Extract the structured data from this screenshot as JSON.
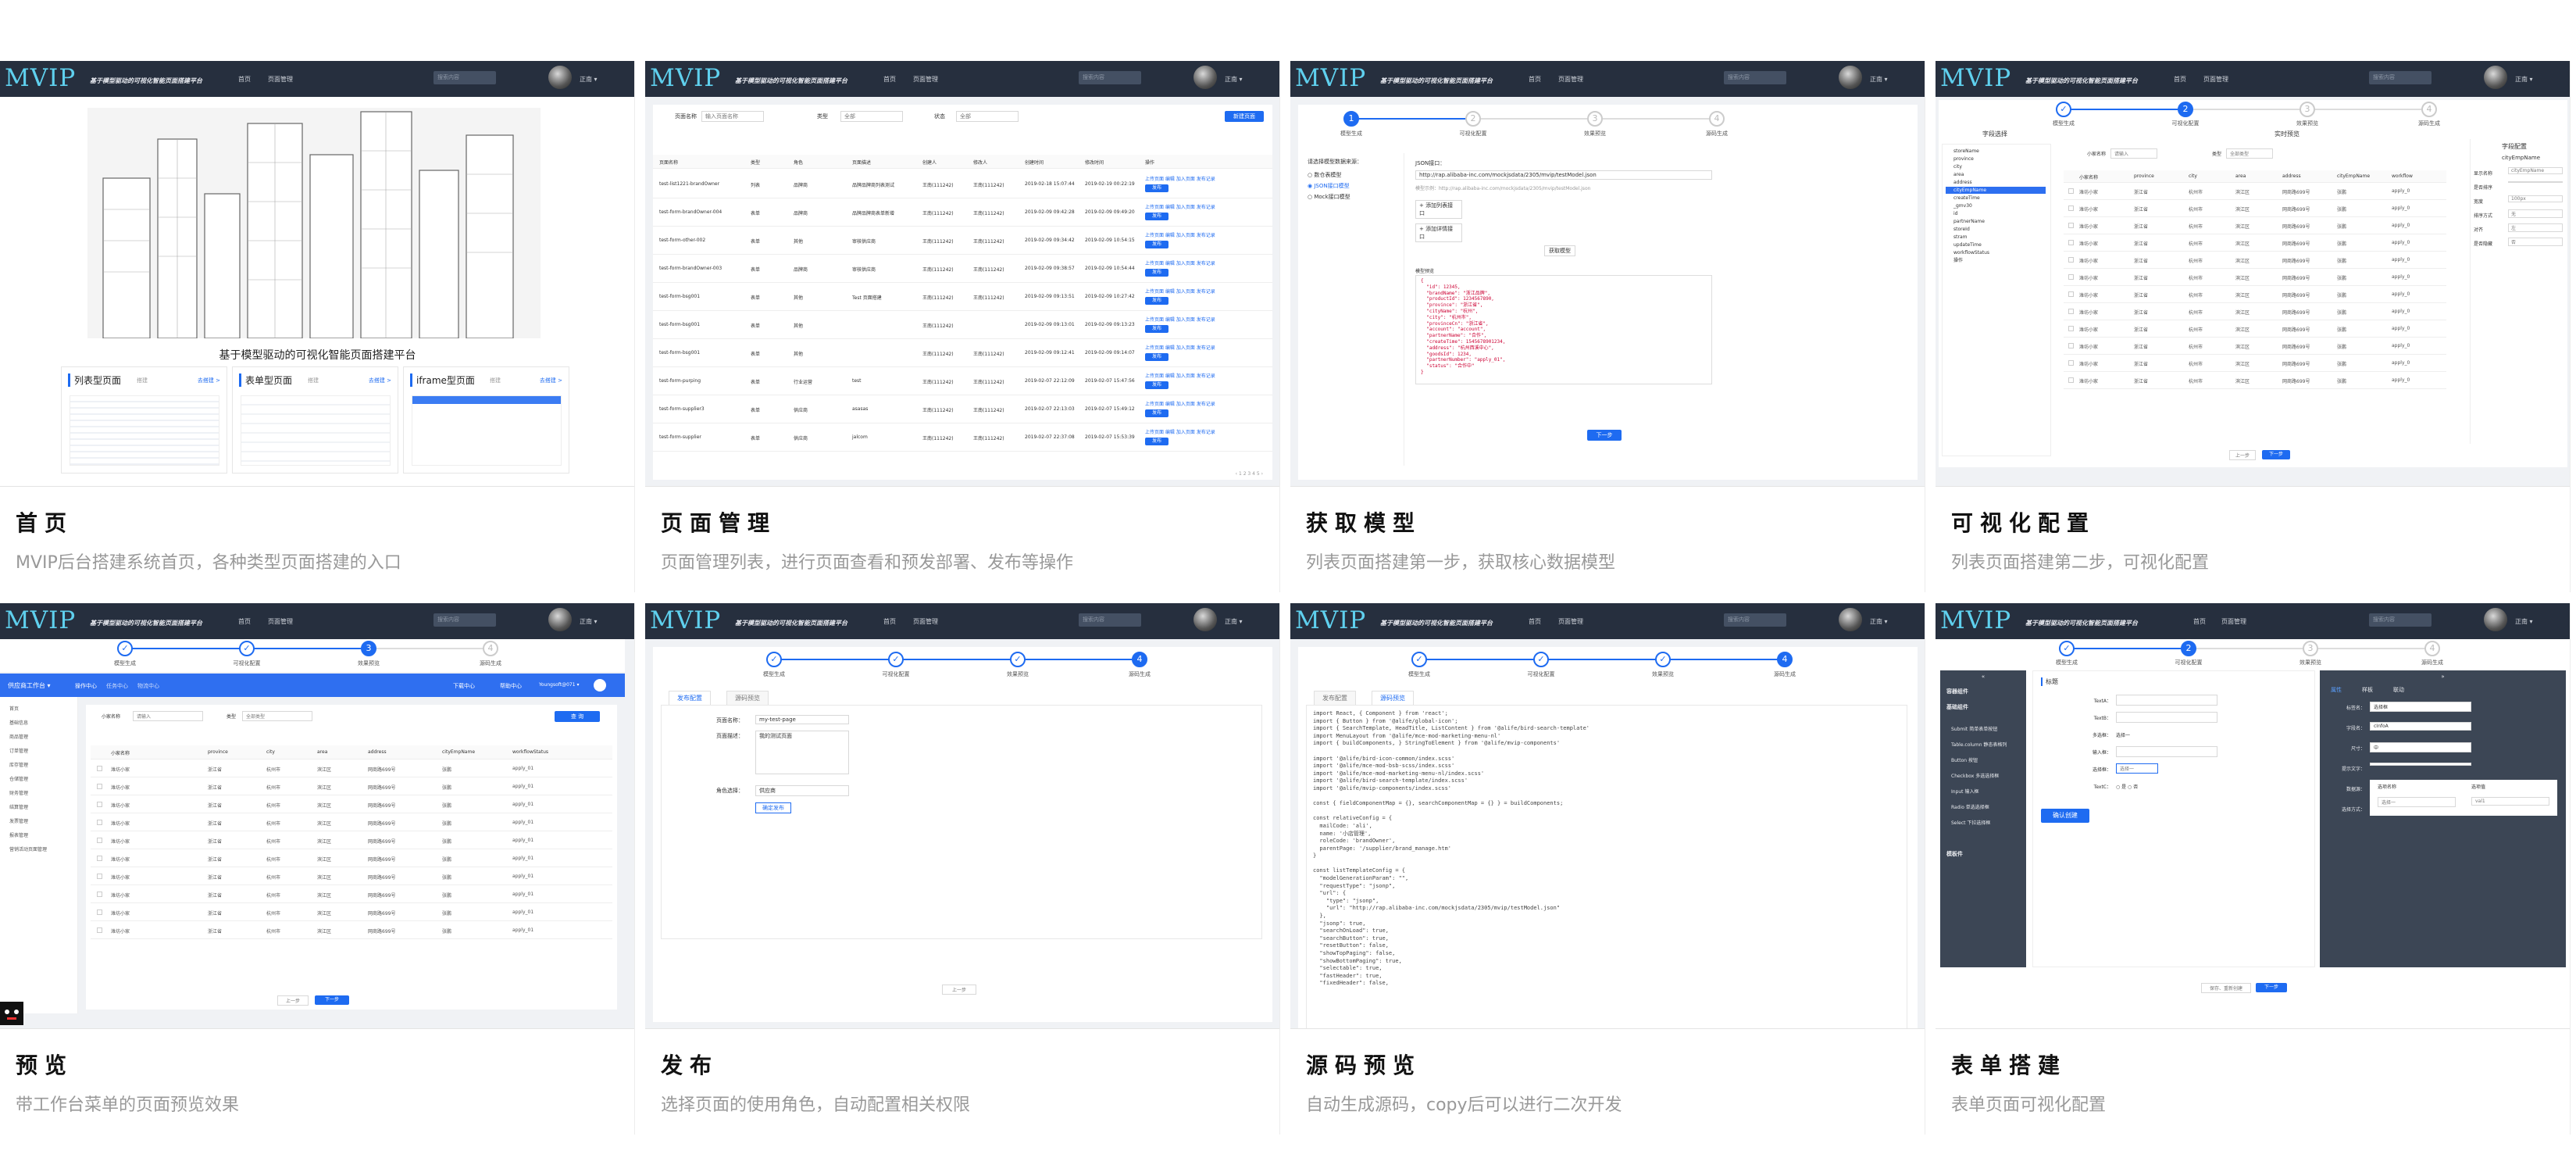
{
  "shared": {
    "logo": "MVIP",
    "subtitle": "基于模型驱动的可视化智能页面搭建平台",
    "nav_home": "首页",
    "nav_pages": "页面管理",
    "search_placeholder": "搜索内容",
    "user": "正南 ▾",
    "step_labels": [
      "模型生成",
      "可视化配置",
      "效果预览",
      "源码生成"
    ],
    "prev": "上一步",
    "next": "下一步"
  },
  "cards": [
    {
      "title": "首页",
      "desc": "MVIP后台搭建系统首页，各种类型页面搭建的入口"
    },
    {
      "title": "页面管理",
      "desc": "页面管理列表，进行页面查看和预发部署、发布等操作"
    },
    {
      "title": "获取模型",
      "desc": "列表页面搭建第一步，获取核心数据模型"
    },
    {
      "title": "可视化配置",
      "desc": "列表页面搭建第二步，可视化配置"
    },
    {
      "title": "预览",
      "desc": "带工作台菜单的页面预览效果"
    },
    {
      "title": "发布",
      "desc": "选择页面的使用角色，自动配置相关权限"
    },
    {
      "title": "源码预览",
      "desc": "自动生成源码，copy后可以进行二次开发"
    },
    {
      "title": "表单搭建",
      "desc": "表单页面可视化配置"
    }
  ],
  "home": {
    "caption": "基于模型驱动的可视化智能页面搭建平台",
    "tiles": [
      {
        "title": "列表型页面",
        "tag": "搭建",
        "link": "去搭建 >"
      },
      {
        "title": "表单型页面",
        "tag": "搭建",
        "link": "去搭建 >"
      },
      {
        "title": "iframe型页面",
        "tag": "搭建",
        "link": "去搭建 >"
      }
    ]
  },
  "pages": {
    "filter_name": "页面名称",
    "filter_name_ph": "输入页面名称",
    "filter_type": "类型",
    "filter_type_val": "全部",
    "filter_status": "状态",
    "filter_status_val": "全部",
    "new_button": "新建页面",
    "columns": [
      "页面名称",
      "类型",
      "角色",
      "页面描述",
      "创建人",
      "修改人",
      "创建时间",
      "修改时间",
      "操作"
    ],
    "rows": [
      [
        "test-list1221-brandOwner",
        "列表",
        "品牌商",
        "品牌品牌商列表测试",
        "王南(111242)",
        "王南(111242)",
        "2019-02-18 15:07:44",
        "2019-02-19 00:22:19"
      ],
      [
        "test-form-brandOwner-004",
        "表单",
        "品牌商",
        "品牌品牌商表单新增",
        "王南(111242)",
        "王南(111242)",
        "2019-02-09 09:42:28",
        "2019-02-09 09:49:20"
      ],
      [
        "test-form-other-002",
        "表单",
        "其他",
        "审核供应商",
        "王南(111242)",
        "王南(111242)",
        "2019-02-09 09:34:42",
        "2019-02-09 10:54:15"
      ],
      [
        "test-form-brandOwner-003",
        "表单",
        "品牌商",
        "审核供应商",
        "王南(111242)",
        "王南(111242)",
        "2019-02-09 09:38:57",
        "2019-02-09 10:54:44"
      ],
      [
        "test-form-bsg001",
        "表单",
        "其他",
        "Test 页面搭建",
        "王南(111242)",
        "王南(111242)",
        "2019-02-09 09:13:51",
        "2019-02-09 10:27:42"
      ],
      [
        "test-form-bsg001",
        "表单",
        "其他",
        "",
        "王南(111242)",
        "",
        "2019-02-09 09:13:01",
        "2019-02-09 09:13:23"
      ],
      [
        "test-form-bsg001",
        "表单",
        "其他",
        "",
        "王南(111242)",
        "王南(111242)",
        "2019-02-09 09:12:41",
        "2019-02-09 09:14:07"
      ],
      [
        "test-form-purping",
        "表单",
        "行业运营",
        "test",
        "王南(111242)",
        "王南(111242)",
        "2019-02-07 22:12:09",
        "2019-02-07 15:47:56"
      ],
      [
        "test-form-supplier3",
        "表单",
        "供应商",
        "asasas",
        "王南(111242)",
        "王南(111242)",
        "2019-02-07 22:13:03",
        "2019-02-07 15:49:12"
      ],
      [
        "test-form-supplier",
        "表单",
        "供应商",
        "jalcom",
        "王南(111242)",
        "王南(111242)",
        "2019-02-07 22:37:08",
        "2019-02-07 15:53:39"
      ]
    ],
    "action_links": "上传页面 编辑 加入页面 发布记录",
    "action_btn": "发布"
  },
  "model": {
    "choose_label": "请选择模型数据来源：",
    "options": [
      "数仓表模型",
      "JSON接口模型",
      "Mock接口模型"
    ],
    "json_label": "JSON接口：",
    "json_url": "http://rap.alibaba-inc.com/mockjsdata/2305/mvip/testModel.json",
    "hint": "模型示例：http://rap.alibaba-inc.com/mockjsdata/2305/mvip/testModel.json",
    "add_list": "+ 添加列表接口",
    "add_detail": "+ 添加详情接口",
    "get_model": "获取模型",
    "preview_label": "模型预览",
    "code": "{\n  \"id\": 12345,\n  \"brandName\": \"浙江品牌\",\n  \"productId\": 1234567890,\n  \"province\": \"浙江省\",\n  \"cityName\": \"杭州\",\n  \"city\": \"杭州市\",\n  \"provinceCn\": \"浙江省\",\n  \"account\": \"account\",\n  \"partnerName\": \"合作\",\n  \"createTime\": 1545678901234,\n  \"address\": \"杭州西溪中心\",\n  \"goodsId\": 1234,\n  \"partnerNumber\": \"apply_01\",\n  \"status\": \"合作中\"\n}"
  },
  "vis": {
    "field_select": "字段选择",
    "live_preview": "实时预览",
    "field_config": "字段配置",
    "fields": [
      "storeName",
      "province",
      "city",
      "area",
      "address",
      "cityEmpName",
      "createTime",
      "_gmv30",
      "id",
      "partnerName",
      "storeId",
      "stram",
      "updateTime",
      "workflowStatus",
      "操作"
    ],
    "filter_label": "小家名称",
    "filter_ph": "请输入",
    "type_label": "类型",
    "type_val": "全部类型",
    "columns": [
      "小家名称",
      "province",
      "city",
      "area",
      "address",
      "cityEmpName",
      "workflow"
    ],
    "cell": [
      "潍坊小家",
      "浙江省",
      "杭州市",
      "滨江区",
      "网商路699号",
      "张鹏",
      "apply_0"
    ],
    "config_name": "cityEmpName",
    "config_rows": [
      [
        "显示名称",
        "cityEmpName"
      ],
      [
        "是否排序",
        ""
      ],
      [
        "宽度",
        "100px"
      ],
      [
        "排序方式",
        "无"
      ],
      [
        "对齐",
        "左"
      ],
      [
        "是否隐藏",
        "否"
      ]
    ]
  },
  "preview": {
    "app_title": "供应商工作台 ▾",
    "topnav": [
      "操作中心",
      "任务中心",
      "物流中心"
    ],
    "right_links": [
      "下载中心",
      "帮助中心",
      "Youngsoft@071 ▾"
    ],
    "menu": [
      "首页",
      "基础信息",
      "商品管理",
      "订单管理",
      "库存管理",
      "仓储管理",
      "财务管理",
      "结算管理",
      "发票管理",
      "报表管理",
      "营销活动页面管理"
    ],
    "filter_label": "小家名称",
    "filter_ph": "请输入",
    "type_label": "类型",
    "type_val": "全部类型",
    "query": "查 询",
    "columns": [
      "小家名称",
      "province",
      "city",
      "area",
      "address",
      "cityEmpName",
      "workflowStatus"
    ],
    "cell": [
      "潍坊小家",
      "浙江省",
      "杭州市",
      "滨江区",
      "网商路699号",
      "张鹏",
      "apply_01"
    ]
  },
  "publish": {
    "tabs": [
      "发布配置",
      "源码预览"
    ],
    "name_label": "页面名称：",
    "name_val": "my-test-page",
    "desc_label": "页面描述：",
    "desc_val": "我的测试页面",
    "role_label": "角色选择：",
    "role_val": "供应商",
    "confirm": "确定发布"
  },
  "source": {
    "tabs": [
      "发布配置",
      "源码预览"
    ],
    "code": "import React, { Component } from 'react';\nimport { Button } from '@alife/global-icon';\nimport { SearchTemplate, HeadTitle, ListContent } from '@alife/bird-search-template'\nimport MenuLayout from '@alife/mce-mod-marketing-menu-nl'\nimport { buildComponents, } StringToElement } from '@alife/mvip-components'\n\nimport '@alife/bird-icon-common/index.scss'\nimport '@alife/mce-mod-bsb-scss/index.scss'\nimport '@alife/mce-mod-marketing-menu-nl/index.scss'\nimport '@alife/bird-search-template/index.scss'\nimport '@alife/mvip-components/index.scss'\n\nconst { fieldComponentMap = {}, searchComponentMap = {} } = buildComponents;\n\nconst relativeConfig = {\n  mailCode: 'ali',\n  name: '小店管理',\n  roleCode: 'brandOwner',\n  parentPage: '/supplier/brand_manage.htm'\n}\n\nconst listTemplateConfig = {\n  \"modelGenerationParam\": \"\",\n  \"requestType\": \"jsonp\",\n  \"url\": {\n    \"type\": \"jsonp\",\n    \"url\": \"http://rap.alibaba-inc.com/mockjsdata/2305/mvip/testModel.json\"\n  },\n  \"jsonp\": true,\n  \"searchOnLoad\": true,\n  \"searchButton\": true,\n  \"resetButton\": false,\n  \"showTopPaging\": false,\n  \"showBottomPaging\": true,\n  \"selectable\": true,\n  \"fastHeader\": true,\n  \"fixedHeader\": false,"
  },
  "form": {
    "left_title": "容器组件",
    "left_groups": [
      "基础组件"
    ],
    "left_items": [
      "Submit 简单表单按钮",
      "Table.column 静态表格列",
      "Button 按钮",
      "Checkbox 多选选择框",
      "Input 输入框",
      "Radio 单选选择框",
      "Select 下拉选择框"
    ],
    "left_bottom": "模板件",
    "canvas_title": "标题",
    "form_fields": [
      "TextA：",
      "TextB：",
      "多选框：",
      "输入框：",
      "选择框：",
      "TextC："
    ],
    "select_ph": "选择一",
    "confirm_create": "确认创建",
    "right_tabs": [
      "属性",
      "样板",
      "联动"
    ],
    "props": [
      [
        "标签名：",
        "选择框"
      ],
      [
        "字段名：",
        "cInfoA"
      ],
      [
        "尺寸：",
        "中"
      ],
      [
        "提示文字：",
        ""
      ],
      [
        "数据源：",
        ""
      ],
      [
        "选择方式：",
        "单选择"
      ]
    ],
    "ds_header": [
      "选项名称",
      "选项值"
    ],
    "ds_row": [
      "选择一",
      "val1"
    ],
    "save_next": "保存、重新创建",
    "next": "下一步"
  }
}
